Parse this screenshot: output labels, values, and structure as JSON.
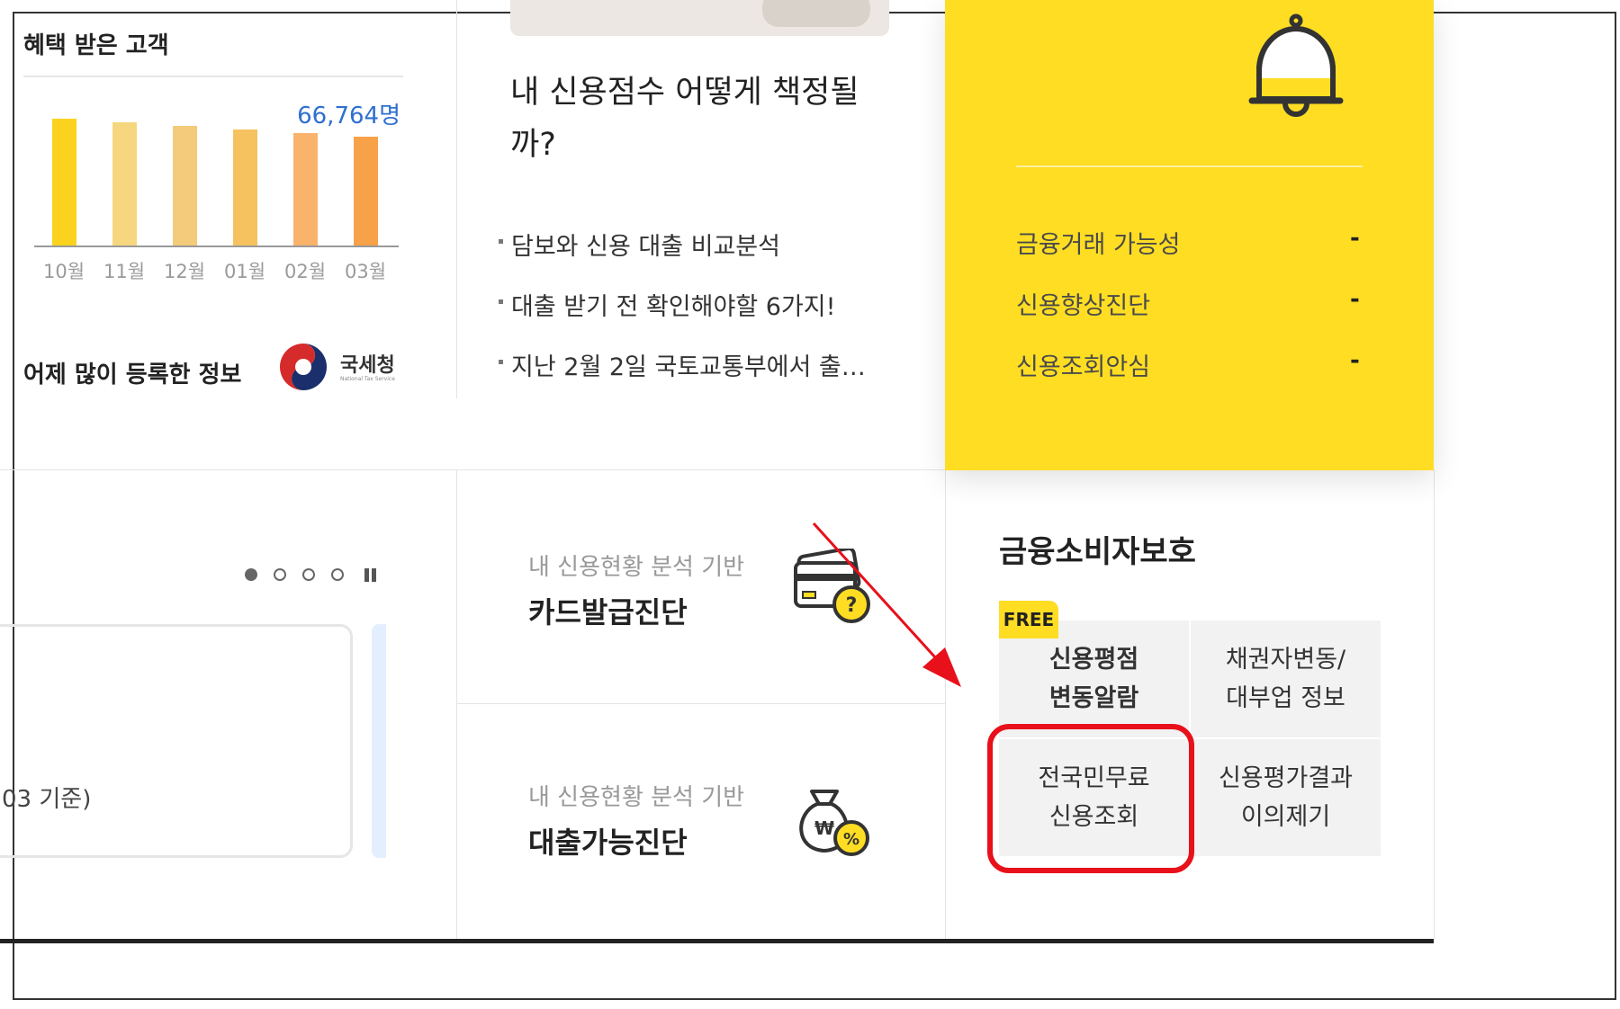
{
  "benefit": {
    "title": "혜택 받은 고객",
    "count_label": "66,764명",
    "chart_data": {
      "type": "bar",
      "categories": [
        "10월",
        "11월",
        "12월",
        "01월",
        "02월",
        "03월"
      ],
      "values": [
        141,
        137,
        133,
        129,
        125,
        121
      ],
      "colors": [
        "#FBD31E",
        "#F6D67E",
        "#F3CB7A",
        "#F5C25F",
        "#F9B36B",
        "#F7A149"
      ]
    }
  },
  "registered": {
    "title": "어제 많이 등록한 정보",
    "logo_text": "국세청",
    "logo_subtext": "National Tax Service"
  },
  "credit_article": {
    "headline_line1": "내 신용점수 어떻게 책정될",
    "headline_line2": "까?",
    "items": [
      "담보와 신용 대출 비교분석",
      "대출 받기 전 확인해야할 6가지!",
      "지난 2월 2일 국토교통부에서 출…"
    ]
  },
  "yellow_panel": {
    "items": [
      {
        "label": "금융거래 가능성",
        "value": "-"
      },
      {
        "label": "신용향상진단",
        "value": "-"
      },
      {
        "label": "신용조회안심",
        "value": "-"
      }
    ]
  },
  "carousel": {
    "date_text": "03 기준)",
    "dot_count": 4,
    "active_dot": 0
  },
  "services": [
    {
      "subtitle": "내 신용현황 분석 기반",
      "title": "카드발급진단"
    },
    {
      "subtitle": "내 신용현황 분석 기반",
      "title": "대출가능진단"
    }
  ],
  "consumer_protection": {
    "title": "금융소비자보호",
    "free_badge": "FREE",
    "cells": [
      {
        "line1": "신용평점",
        "line2": "변동알람"
      },
      {
        "line1": "채권자변동/",
        "line2": "대부업 정보"
      },
      {
        "line1": "전국민무료",
        "line2": "신용조회"
      },
      {
        "line1": "신용평가결과",
        "line2": "이의제기"
      }
    ]
  },
  "colors": {
    "yellow": "#FEDD23",
    "highlight_red": "#E8101A",
    "accent_blue": "#2E6FD0"
  }
}
